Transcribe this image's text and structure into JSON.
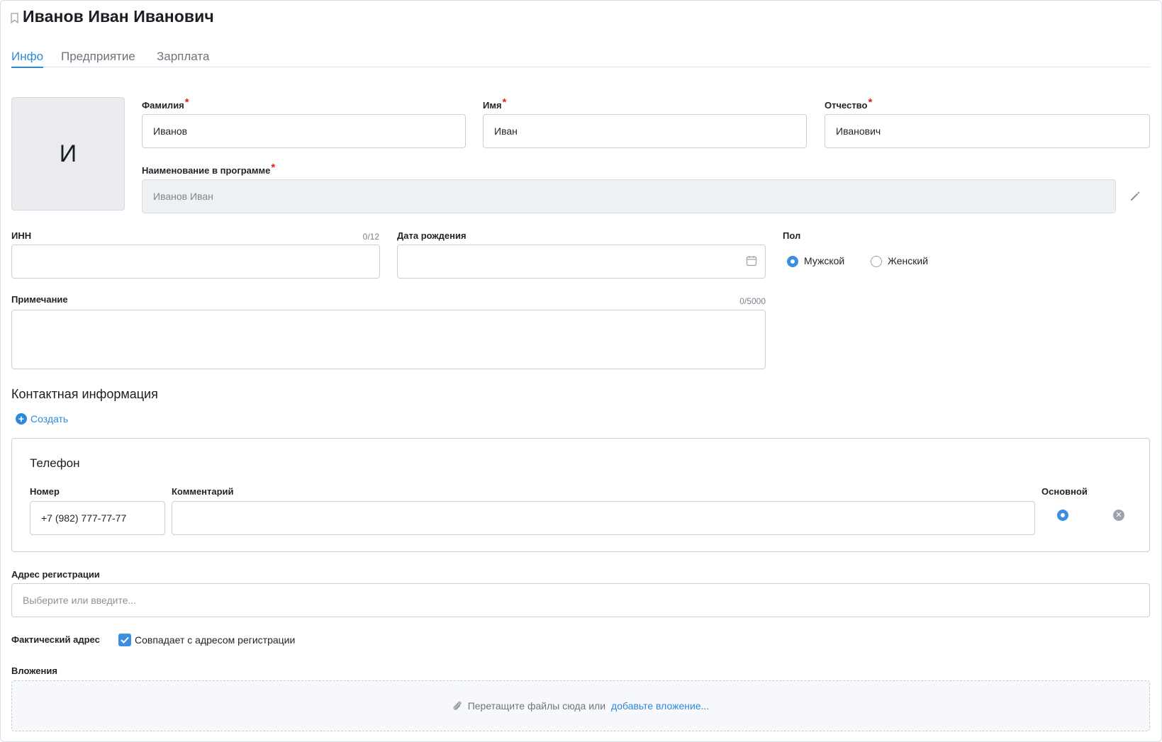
{
  "header": {
    "title": "Иванов Иван Иванович"
  },
  "tabs": [
    {
      "label": "Инфо",
      "active": true
    },
    {
      "label": "Предприятие",
      "active": false
    },
    {
      "label": "Зарплата",
      "active": false
    }
  ],
  "avatar": {
    "initial": "И"
  },
  "fields": {
    "last_name": {
      "label": "Фамилия",
      "value": "Иванов",
      "required": "*"
    },
    "first_name": {
      "label": "Имя",
      "value": "Иван",
      "required": "*"
    },
    "patronymic": {
      "label": "Отчество",
      "value": "Иванович",
      "required": "*"
    },
    "display_name": {
      "label": "Наименование в программе",
      "value": "Иванов Иван",
      "required": "*"
    },
    "inn": {
      "label": "ИНН",
      "value": "",
      "counter": "0/12"
    },
    "birth_date": {
      "label": "Дата рождения",
      "value": ""
    },
    "gender": {
      "label": "Пол",
      "options": [
        "Мужской",
        "Женский"
      ],
      "selected": "Мужской"
    },
    "note": {
      "label": "Примечание",
      "value": "",
      "counter": "0/5000"
    }
  },
  "contacts": {
    "title": "Контактная информация",
    "create_label": "Создать",
    "phone": {
      "title": "Телефон",
      "number_label": "Номер",
      "number_value": "+7 (982) 777-77-77",
      "comment_label": "Комментарий",
      "comment_value": "",
      "primary_label": "Основной"
    }
  },
  "address": {
    "reg_label": "Адрес регистрации",
    "reg_placeholder": "Выберите или введите...",
    "actual_label": "Фактический адрес",
    "same_label": "Совпадает с адресом регистрации",
    "same_checked": true
  },
  "attachments": {
    "label": "Вложения",
    "drop_text": "Перетащите файлы сюда или",
    "drop_link": "добавьте вложение..."
  },
  "colors": {
    "accent": "#2d8ad8",
    "required": "#e02020",
    "border": "#c9cfd6"
  }
}
